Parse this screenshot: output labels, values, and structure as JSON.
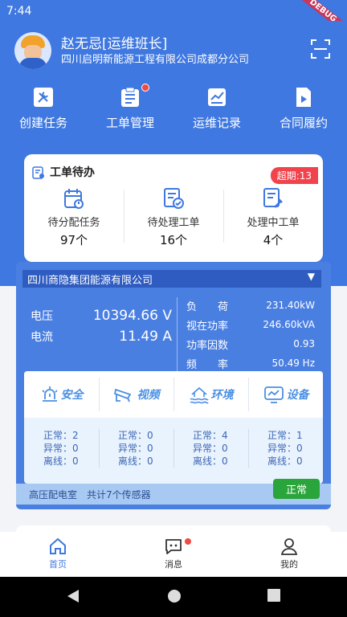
{
  "status_bar": {
    "time": "7:44",
    "debug_ribbon": "DEBUG"
  },
  "header": {
    "user_name": "赵无忌[运维班长]",
    "company": "四川启明新能源工程有限公司成都分公司"
  },
  "quick_actions": [
    {
      "label": "创建任务",
      "icon": "wrench-icon"
    },
    {
      "label": "工单管理",
      "icon": "clipboard-icon",
      "has_badge": true
    },
    {
      "label": "运维记录",
      "icon": "chart-record-icon"
    },
    {
      "label": "合同履约",
      "icon": "document-play-icon"
    }
  ],
  "work_orders": {
    "title": "工单待办",
    "overdue": "超期:13",
    "stats": [
      {
        "label": "待分配任务",
        "count": "97个",
        "icon": "calendar-alert-icon"
      },
      {
        "label": "待处理工单",
        "count": "16个",
        "icon": "form-check-icon"
      },
      {
        "label": "处理中工单",
        "count": "4个",
        "icon": "form-tool-icon"
      }
    ]
  },
  "power": {
    "company_select": "四川商隐集团能源有限公司",
    "voltage_label": "电压",
    "voltage_value": "10394.66 V",
    "current_label": "电流",
    "current_value": "11.49 A",
    "metrics": [
      {
        "label": "负　　荷",
        "value": "231.40kW"
      },
      {
        "label": "视在功率",
        "value": "246.60kVA"
      },
      {
        "label": "功率因数",
        "value": "0.93"
      },
      {
        "label": "频　　率",
        "value": "50.49 Hz"
      }
    ]
  },
  "sensors": {
    "tabs": [
      {
        "label": "安全",
        "icon": "alarm-light-icon"
      },
      {
        "label": "视频",
        "icon": "camera-icon"
      },
      {
        "label": "环境",
        "icon": "environment-icon"
      },
      {
        "label": "设备",
        "icon": "monitor-icon"
      }
    ],
    "columns": [
      {
        "normal": "正常：2",
        "abnormal": "异常：0",
        "offline": "离线：0"
      },
      {
        "normal": "正常：0",
        "abnormal": "异常：0",
        "offline": "离线：0"
      },
      {
        "normal": "正常：4",
        "abnormal": "异常：0",
        "offline": "离线：0"
      },
      {
        "normal": "正常：1",
        "abnormal": "异常：0",
        "offline": "离线：0"
      }
    ],
    "footer": "高压配电室　共计7个传感器",
    "status": "正常"
  },
  "tabbar": [
    {
      "label": "首页",
      "icon": "home-icon",
      "active": true
    },
    {
      "label": "消息",
      "icon": "message-icon",
      "has_badge": true
    },
    {
      "label": "我的",
      "icon": "user-icon"
    }
  ],
  "colors": {
    "primary": "#3f78e0",
    "danger": "#f1434c",
    "success": "#2aa53b"
  }
}
